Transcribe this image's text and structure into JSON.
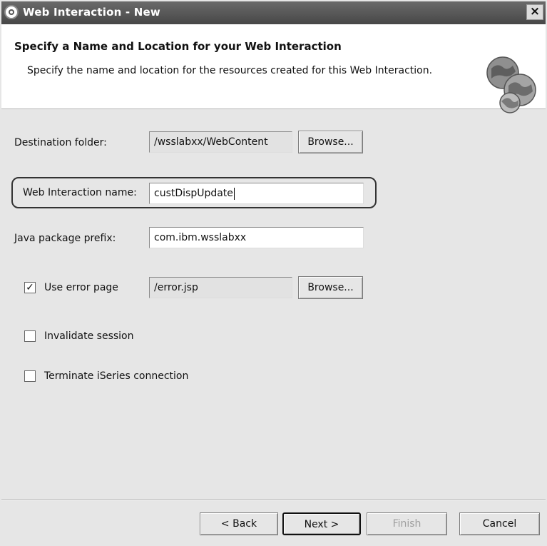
{
  "window": {
    "title": "Web Interaction - New",
    "close_label": "×"
  },
  "header": {
    "heading": "Specify a Name and Location for your Web Interaction",
    "description": "Specify the name and location for the resources created for this Web Interaction.",
    "icon": "globe-icon"
  },
  "form": {
    "destination_folder": {
      "label": "Destination folder:",
      "value": "/wsslabxx/WebContent",
      "browse_label": "Browse..."
    },
    "web_interaction_name": {
      "label": "Web Interaction name:",
      "value": "custDispUpdate"
    },
    "java_package_prefix": {
      "label": "Java package prefix:",
      "value": "com.ibm.wsslabxx"
    },
    "use_error_page": {
      "label": "Use error page",
      "checked": true,
      "check_mark": "✓",
      "value": "/error.jsp",
      "browse_label": "Browse..."
    },
    "invalidate_session": {
      "label": "Invalidate session",
      "checked": false
    },
    "terminate_iseries": {
      "label": "Terminate iSeries connection",
      "checked": false
    }
  },
  "buttons": {
    "back": "< Back",
    "next": "Next >",
    "finish": "Finish",
    "cancel": "Cancel"
  },
  "colors": {
    "titlebar": "#474747",
    "dialog_bg": "#e6e6e6",
    "header_bg": "#ffffff",
    "highlight_border": "#333333"
  }
}
